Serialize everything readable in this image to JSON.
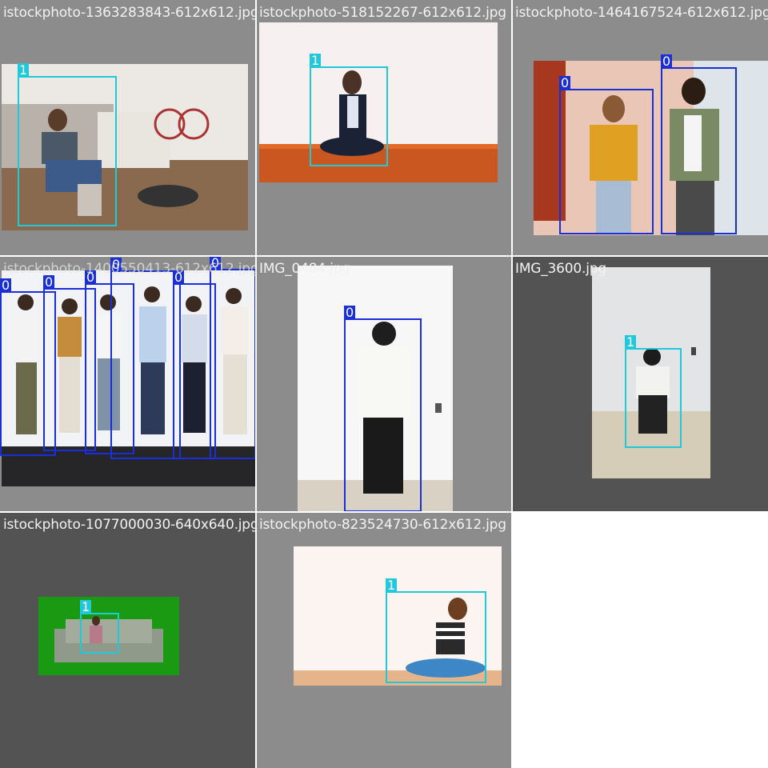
{
  "mosaic": {
    "tiles": [
      {
        "caption": "istockphoto-1363283843-612x612.jpg",
        "boxes": [
          {
            "label": "1"
          }
        ]
      },
      {
        "caption": "istockphoto-518152267-612x612.jpg",
        "boxes": [
          {
            "label": "1"
          }
        ]
      },
      {
        "caption": "istockphoto-1464167524-612x612.jpg",
        "boxes": [
          {
            "label": "0"
          },
          {
            "label": "0"
          }
        ]
      },
      {
        "caption": "istockphoto-1400550413-612x612.jpg",
        "boxes": [
          {
            "label": "0"
          },
          {
            "label": "0"
          },
          {
            "label": "0"
          },
          {
            "label": "0"
          },
          {
            "label": "0"
          },
          {
            "label": "0"
          }
        ]
      },
      {
        "caption": "IMG_0484.jpg",
        "boxes": [
          {
            "label": "0"
          }
        ]
      },
      {
        "caption": "IMG_3600.jpg",
        "boxes": [
          {
            "label": "1"
          }
        ]
      },
      {
        "caption": "istockphoto-1077000030-640x640.jpg",
        "boxes": [
          {
            "label": "1"
          }
        ]
      },
      {
        "caption": "istockphoto-823524730-612x612.jpg",
        "boxes": [
          {
            "label": "1"
          }
        ]
      }
    ]
  },
  "colors": {
    "class_0": "#1a2fd6",
    "class_1": "#20c8dc",
    "padding_dark": "#535353",
    "padding_mid": "#8c8c8c"
  }
}
